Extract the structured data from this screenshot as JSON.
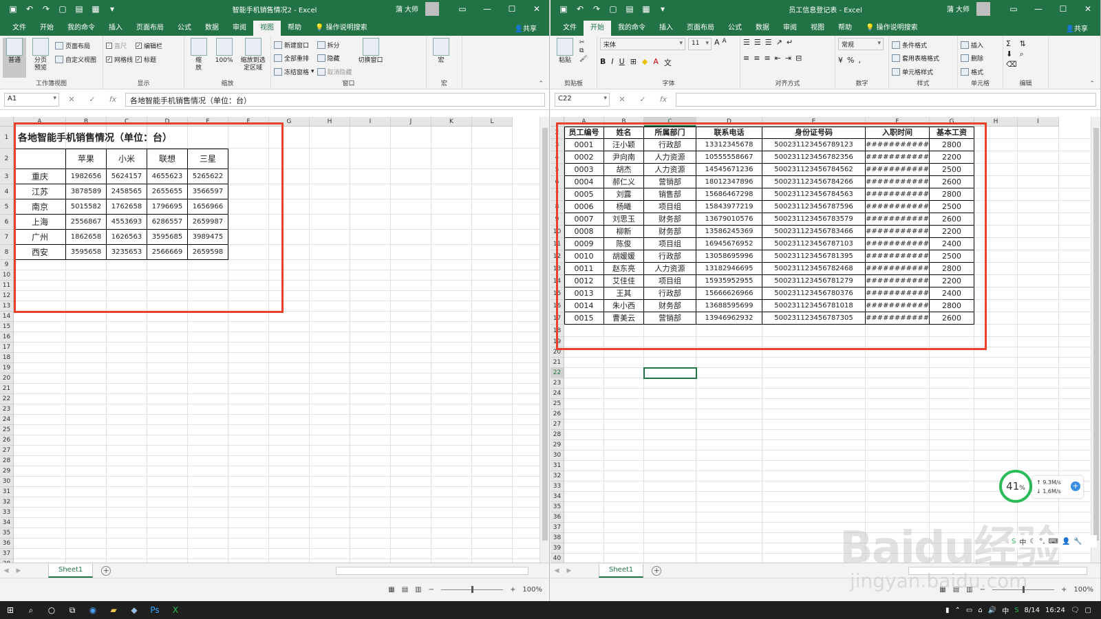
{
  "left": {
    "title": "智能手机销售情况2 - Excel",
    "user": "蒲 大师",
    "tabs": [
      "文件",
      "开始",
      "我的命令",
      "插入",
      "页面布局",
      "公式",
      "数据",
      "审阅",
      "视图",
      "帮助"
    ],
    "active_tab": "视图",
    "tell_me": "操作说明搜索",
    "share": "共享",
    "ribbon": {
      "workbook_views_label": "工作簿视图",
      "normal": "普通",
      "page_break": "分页预览",
      "page_layout": "页面布局",
      "custom_views": "自定义视图",
      "show_label": "显示",
      "ruler": "直尺",
      "gridlines": "网格线",
      "formula_bar": "编辑栏",
      "headings": "标题",
      "zoom_label": "缩放",
      "zoom": "缩放",
      "zoom100": "100%",
      "zoom_selection": "缩放到选定区域",
      "window_label": "窗口",
      "new_window": "新建窗口",
      "arrange_all": "全部重排",
      "freeze_panes": "冻结窗格",
      "split": "拆分",
      "hide": "隐藏",
      "unhide": "取消隐藏",
      "switch_windows": "切换窗口",
      "macros_label": "宏",
      "macros": "宏"
    },
    "namebox": "A1",
    "formula": "各地智能手机销售情况（单位：台）",
    "columns": [
      "A",
      "B",
      "C",
      "D",
      "E",
      "F",
      "G",
      "H",
      "I",
      "J",
      "K",
      "L"
    ],
    "sheet_title": "各地智能手机销售情况（单位：台）",
    "headers": [
      "苹果",
      "小米",
      "联想",
      "三星"
    ],
    "rows": [
      [
        "重庆",
        "1982656",
        "5624157",
        "4655623",
        "5265622"
      ],
      [
        "江苏",
        "3878589",
        "2458565",
        "2655655",
        "3566597"
      ],
      [
        "南京",
        "5015582",
        "1762658",
        "1796695",
        "1656966"
      ],
      [
        "上海",
        "2556867",
        "4553693",
        "6286557",
        "2659987"
      ],
      [
        "广州",
        "1862658",
        "1626563",
        "3595685",
        "3989475"
      ],
      [
        "西安",
        "3595658",
        "3235653",
        "2566669",
        "2659598"
      ]
    ],
    "sheet_tab": "Sheet1",
    "zoom_level": "100%"
  },
  "right": {
    "title": "员工信息登记表 - Excel",
    "user": "蒲 大师",
    "tabs": [
      "文件",
      "开始",
      "我的命令",
      "插入",
      "页面布局",
      "公式",
      "数据",
      "审阅",
      "视图",
      "帮助"
    ],
    "active_tab": "开始",
    "tell_me": "操作说明搜索",
    "share": "共享",
    "ribbon": {
      "clipboard_label": "剪贴板",
      "paste": "粘贴",
      "font_label": "字体",
      "font_name": "宋体",
      "font_size": "11",
      "align_label": "对齐方式",
      "number_label": "数字",
      "number_format": "常规",
      "styles_label": "样式",
      "cond_format": "条件格式",
      "table_format": "套用表格格式",
      "cell_styles": "单元格样式",
      "cells_label": "单元格",
      "insert": "插入",
      "delete": "删除",
      "format": "格式",
      "edit_label": "编辑"
    },
    "namebox": "C22",
    "formula": "",
    "columns": [
      "A",
      "B",
      "C",
      "D",
      "E",
      "F",
      "G",
      "H",
      "I"
    ],
    "headers": [
      "员工编号",
      "姓名",
      "所属部门",
      "联系电话",
      "身份证号码",
      "入职时间",
      "基本工资"
    ],
    "rows": [
      [
        "0001",
        "汪小颖",
        "行政部",
        "13312345678",
        "500231123456789123",
        "############",
        "2800"
      ],
      [
        "0002",
        "尹向南",
        "人力资源",
        "10555558667",
        "500231123456782356",
        "############",
        "2200"
      ],
      [
        "0003",
        "胡杰",
        "人力资源",
        "14545671236",
        "500231123456784562",
        "############",
        "2500"
      ],
      [
        "0004",
        "郝仁义",
        "营销部",
        "18012347896",
        "500231123456784266",
        "############",
        "2600"
      ],
      [
        "0005",
        "刘露",
        "销售部",
        "15686467298",
        "500231123456784563",
        "############",
        "2800"
      ],
      [
        "0006",
        "杨曦",
        "项目组",
        "15843977219",
        "500231123456787596",
        "############",
        "2500"
      ],
      [
        "0007",
        "刘思玉",
        "财务部",
        "13679010576",
        "500231123456783579",
        "############",
        "2600"
      ],
      [
        "0008",
        "柳新",
        "财务部",
        "13586245369",
        "500231123456783466",
        "############",
        "2200"
      ],
      [
        "0009",
        "陈俊",
        "项目组",
        "16945676952",
        "500231123456787103",
        "############",
        "2400"
      ],
      [
        "0010",
        "胡媛媛",
        "行政部",
        "13058695996",
        "500231123456781395",
        "############",
        "2500"
      ],
      [
        "0011",
        "赵东亮",
        "人力资源",
        "13182946695",
        "500231123456782468",
        "############",
        "2800"
      ],
      [
        "0012",
        "艾佳佳",
        "项目组",
        "15935952955",
        "500231123456781279",
        "############",
        "2200"
      ],
      [
        "0013",
        "王其",
        "行政部",
        "15666626966",
        "500231123456780376",
        "############",
        "2400"
      ],
      [
        "0014",
        "朱小西",
        "财务部",
        "13688595699",
        "500231123456781018",
        "############",
        "2800"
      ],
      [
        "0015",
        "曹美云",
        "营销部",
        "13946962932",
        "500231123456787305",
        "############",
        "2600"
      ]
    ],
    "sheet_tab": "Sheet1",
    "zoom_level": "100%"
  },
  "overlay": {
    "net_percent": "41",
    "net_unit": "%",
    "upload": "9.3M/s",
    "download": "1.6M/s",
    "watermark": "Baidu经验",
    "watermark_url": "jingyan.baidu.com"
  },
  "taskbar": {
    "time": "16:24",
    "date": "8/14"
  }
}
